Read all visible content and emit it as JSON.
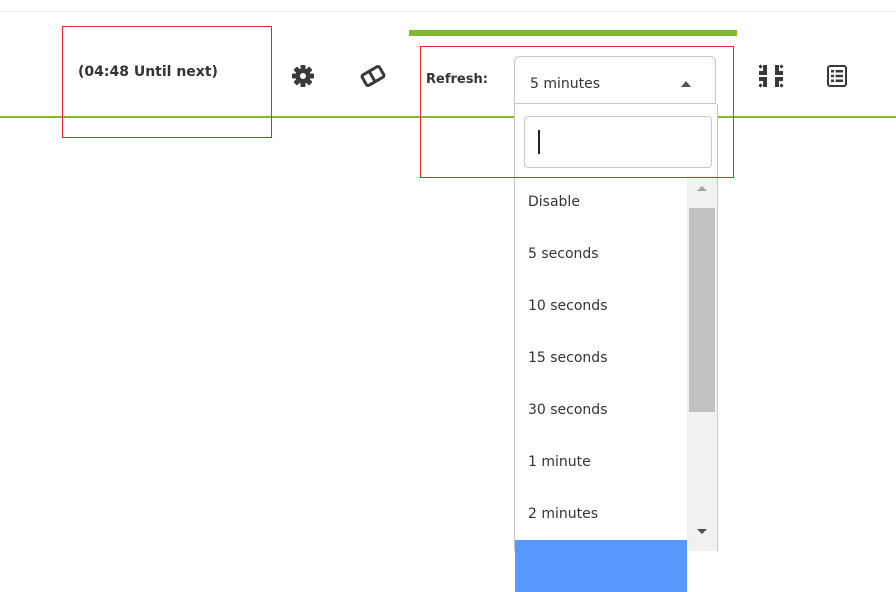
{
  "toolbar": {
    "countdown_text": "(04:48 Until next)",
    "refresh_label": "Refresh:",
    "icons": {
      "settings": "gear-icon",
      "edit": "eraser-icon",
      "fullscreen": "compress-arrows-icon",
      "table": "table-icon"
    },
    "refresh_progress": 1.0
  },
  "refresh_select": {
    "selected": "5 minutes",
    "search_value": "",
    "options": [
      "Disable",
      "5 seconds",
      "10 seconds",
      "15 seconds",
      "30 seconds",
      "1 minute",
      "2 minutes",
      ""
    ]
  },
  "colors": {
    "accent": "#82b92e",
    "annotation": "#e8262e",
    "option_highlight": "#5897fb"
  }
}
